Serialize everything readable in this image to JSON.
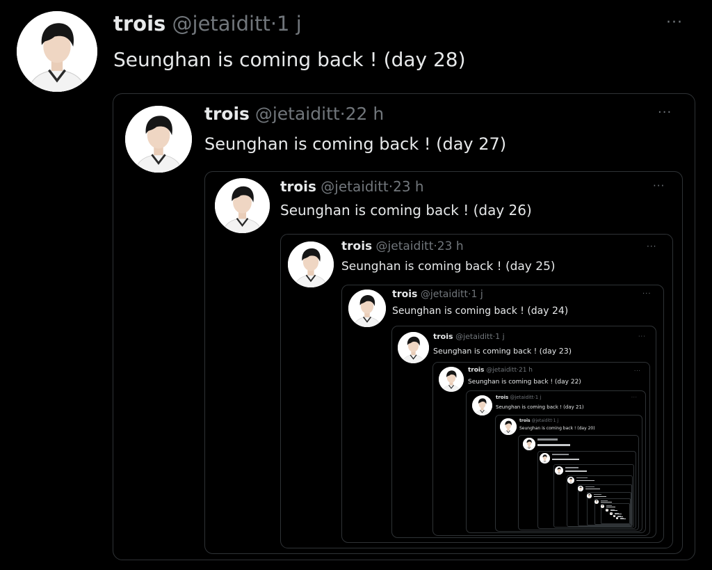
{
  "tweets": [
    {
      "display_name": "trois",
      "handle": "@jetaiditt",
      "sep": "·",
      "time": "1 j",
      "text": "Seunghan is coming back ! (day 28)"
    },
    {
      "display_name": "trois",
      "handle": "@jetaiditt",
      "sep": "·",
      "time": "22 h",
      "text": "Seunghan is coming back ! (day 27)"
    },
    {
      "display_name": "trois",
      "handle": "@jetaiditt",
      "sep": "·",
      "time": "23 h",
      "text": "Seunghan is coming back ! (day 26)"
    },
    {
      "display_name": "trois",
      "handle": "@jetaiditt",
      "sep": "·",
      "time": "23 h",
      "text": "Seunghan is coming back ! (day 25)"
    },
    {
      "display_name": "trois",
      "handle": "@jetaiditt",
      "sep": "·",
      "time": "1 j",
      "text": "Seunghan is coming back ! (day 24)"
    },
    {
      "display_name": "trois",
      "handle": "@jetaiditt",
      "sep": "·",
      "time": "1 j",
      "text": "Seunghan is coming back ! (day 23)"
    },
    {
      "display_name": "trois",
      "handle": "@jetaiditt",
      "sep": "·",
      "time": "21 h",
      "text": "Seunghan is coming back ! (day 22)"
    },
    {
      "display_name": "trois",
      "handle": "@jetaiditt",
      "sep": "·",
      "time": "1 j",
      "text": "Seunghan is coming back ! (day 21)"
    },
    {
      "display_name": "trois",
      "handle": "@jetaiditt",
      "sep": "·",
      "time": "1 j",
      "text": "Seunghan is coming back ! (day 20)"
    }
  ],
  "more_label": "···",
  "icons": {
    "avatar": "profile-photo",
    "more": "more-icon"
  },
  "colors": {
    "background": "#000000",
    "text": "#e7e9ea",
    "muted": "#71767b",
    "border": "#2f3336"
  }
}
